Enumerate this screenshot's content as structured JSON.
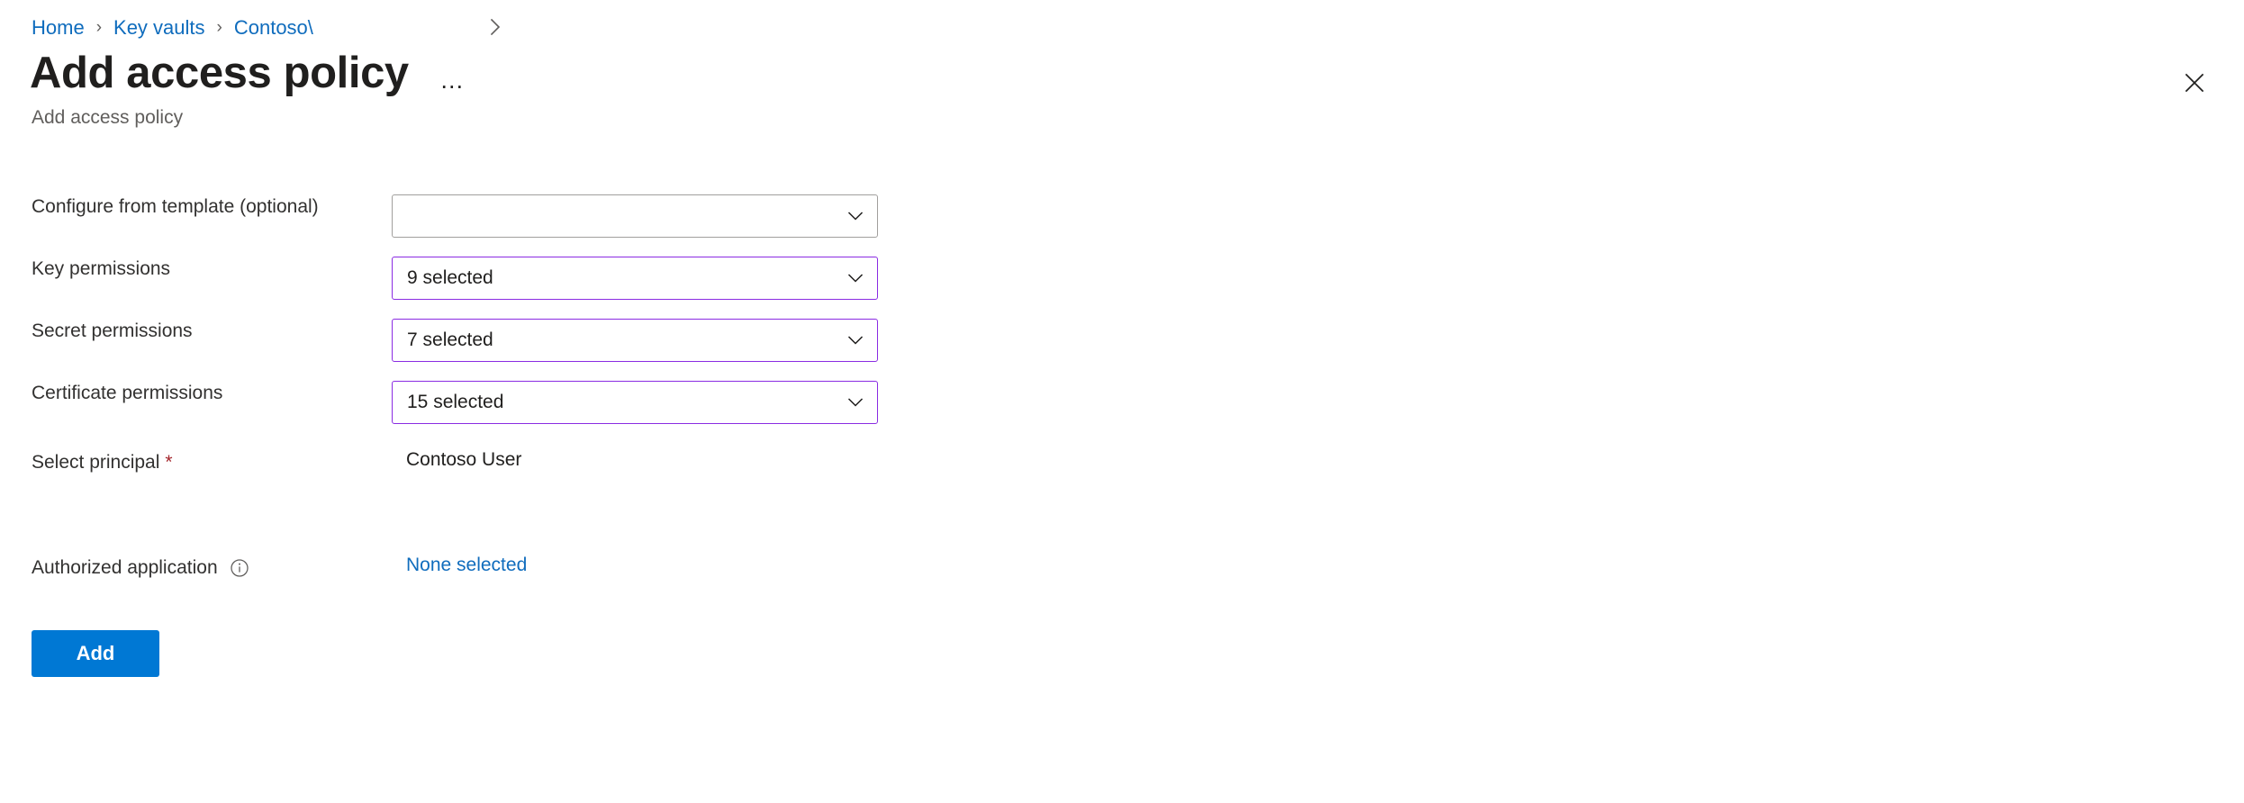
{
  "breadcrumb": {
    "items": [
      {
        "label": "Home",
        "truncated": false
      },
      {
        "label": "Key vaults",
        "truncated": false
      },
      {
        "label": "Contoso\\",
        "truncated": true
      }
    ],
    "separator": "›",
    "overflow_chevron": "chevron-right-icon"
  },
  "header": {
    "title": "Add access policy",
    "subtitle": "Add access policy",
    "more_menu": "…",
    "close_icon": "close-icon"
  },
  "form": {
    "rows": [
      {
        "key": "template",
        "label": "Configure from template (optional)",
        "control": "dropdown",
        "value": "",
        "modified": false
      },
      {
        "key": "key_permissions",
        "label": "Key permissions",
        "control": "dropdown",
        "value": "9 selected",
        "modified": true
      },
      {
        "key": "secret_permissions",
        "label": "Secret permissions",
        "control": "dropdown",
        "value": "7 selected",
        "modified": true
      },
      {
        "key": "certificate_permissions",
        "label": "Certificate permissions",
        "control": "dropdown",
        "value": "15 selected",
        "modified": true
      },
      {
        "key": "select_principal",
        "label": "Select principal",
        "required": true,
        "required_marker": "*",
        "control": "static",
        "value": "Contoso User"
      },
      {
        "key": "authorized_application",
        "label": "Authorized application",
        "info_icon": "info-circle-icon",
        "control": "link",
        "value": "None selected"
      }
    ]
  },
  "actions": {
    "add_label": "Add"
  },
  "colors": {
    "link": "#0f6cbd",
    "primary_button": "#0078d4",
    "modified_border": "#8a2be2",
    "default_border": "#a19f9d",
    "required": "#a4262c",
    "subtitle": "#605e5c"
  }
}
